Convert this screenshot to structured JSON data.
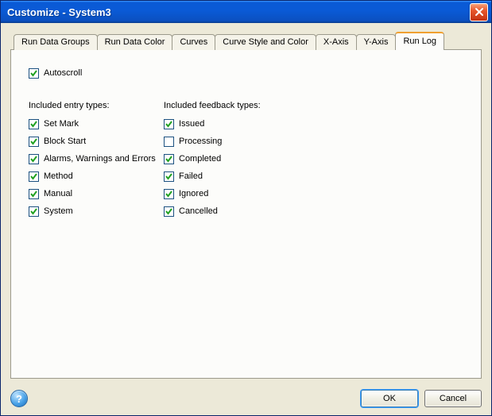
{
  "title": "Customize - System3",
  "tabs": [
    {
      "label": "Run Data Groups",
      "active": false
    },
    {
      "label": "Run Data Color",
      "active": false
    },
    {
      "label": "Curves",
      "active": false
    },
    {
      "label": "Curve Style and Color",
      "active": false
    },
    {
      "label": "X-Axis",
      "active": false
    },
    {
      "label": "Y-Axis",
      "active": false
    },
    {
      "label": "Run Log",
      "active": true
    }
  ],
  "autoscroll": {
    "label": "Autoscroll",
    "checked": true
  },
  "entry_section": "Included entry types:",
  "feedback_section": "Included feedback types:",
  "entries": [
    {
      "label": "Set Mark",
      "checked": true
    },
    {
      "label": "Block Start",
      "checked": true
    },
    {
      "label": "Alarms, Warnings and Errors",
      "checked": true
    },
    {
      "label": "Method",
      "checked": true
    },
    {
      "label": "Manual",
      "checked": true
    },
    {
      "label": "System",
      "checked": true
    }
  ],
  "feedbacks": [
    {
      "label": "Issued",
      "checked": true
    },
    {
      "label": "Processing",
      "checked": false
    },
    {
      "label": "Completed",
      "checked": true
    },
    {
      "label": "Failed",
      "checked": true
    },
    {
      "label": "Ignored",
      "checked": true
    },
    {
      "label": "Cancelled",
      "checked": true
    }
  ],
  "buttons": {
    "ok": "OK",
    "cancel": "Cancel"
  },
  "help_glyph": "?"
}
